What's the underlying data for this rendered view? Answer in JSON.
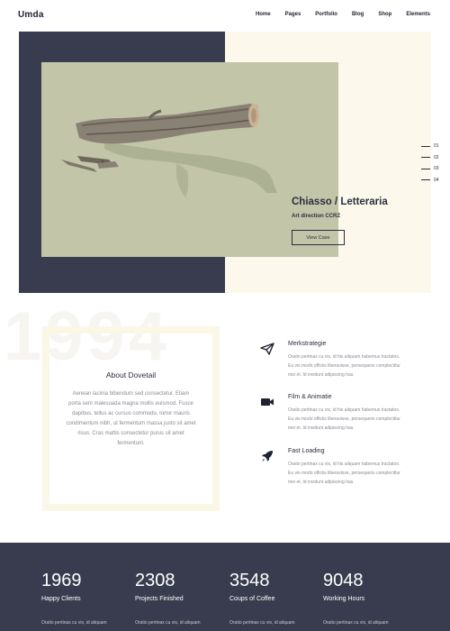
{
  "header": {
    "logo": "Umda",
    "nav": [
      "Home",
      "Pages",
      "Portfolio",
      "Blog",
      "Shop",
      "Elements"
    ]
  },
  "hero": {
    "title": "Chiasso / Letteraria",
    "subtitle": "Art direction CCRZ",
    "button": "View Case",
    "pager": [
      "01",
      "02",
      "03",
      "04"
    ]
  },
  "about": {
    "background_year": "1994",
    "title": "About Dovetail",
    "text": "Aenean lacinia bibendum sed consectetur. Etiam porta sem malesuada magna mollis euismod. Fusce dapibus, tellus ac cursus commodo, tortor mauris condimentum nibh, ut fermentum massa justo sit amet risus. Cras mattis consectetur purus sit amet fermentum."
  },
  "features": [
    {
      "icon": "paper-plane-icon",
      "title": "Merkstrategie",
      "text": "Oratio pertinax cu vix, id his aliquam habemus tractatos. Eu vis modo officiis liberavisse, persequeris complectitur mei et. Id invidunt adipiscing has."
    },
    {
      "icon": "video-camera-icon",
      "title": "Film & Animatie",
      "text": "Oratio pertinax cu vix, id his aliquam habemus tractatos. Eu vis modo officiis liberavisse, persequeris complectitur mei et. Id invidunt adipiscing has."
    },
    {
      "icon": "rocket-icon",
      "title": "Fast Loading",
      "text": "Oratio pertinax cu vix, id his aliquam habemus tractatos. Eu vis modo officiis liberavisse, persequeris complectitur mei et. Id invidunt adipiscing has."
    }
  ],
  "stats": [
    {
      "number": "1969",
      "label": "Happy Clients",
      "text": "Oratio pertinax cu vix, id aliquam"
    },
    {
      "number": "2308",
      "label": "Projects Finished",
      "text": "Oratio pertinax cu vix, id aliquam"
    },
    {
      "number": "3548",
      "label": "Coups of Coffee",
      "text": "Oratio pertinax cu vix, id aliquam"
    },
    {
      "number": "9048",
      "label": "Working Hours",
      "text": "Oratio pertinax cu vix, id aliquam"
    }
  ],
  "colors": {
    "dark": "#393c4f",
    "cream": "#fcf9ec",
    "photo_bg": "#c2c5a8"
  }
}
